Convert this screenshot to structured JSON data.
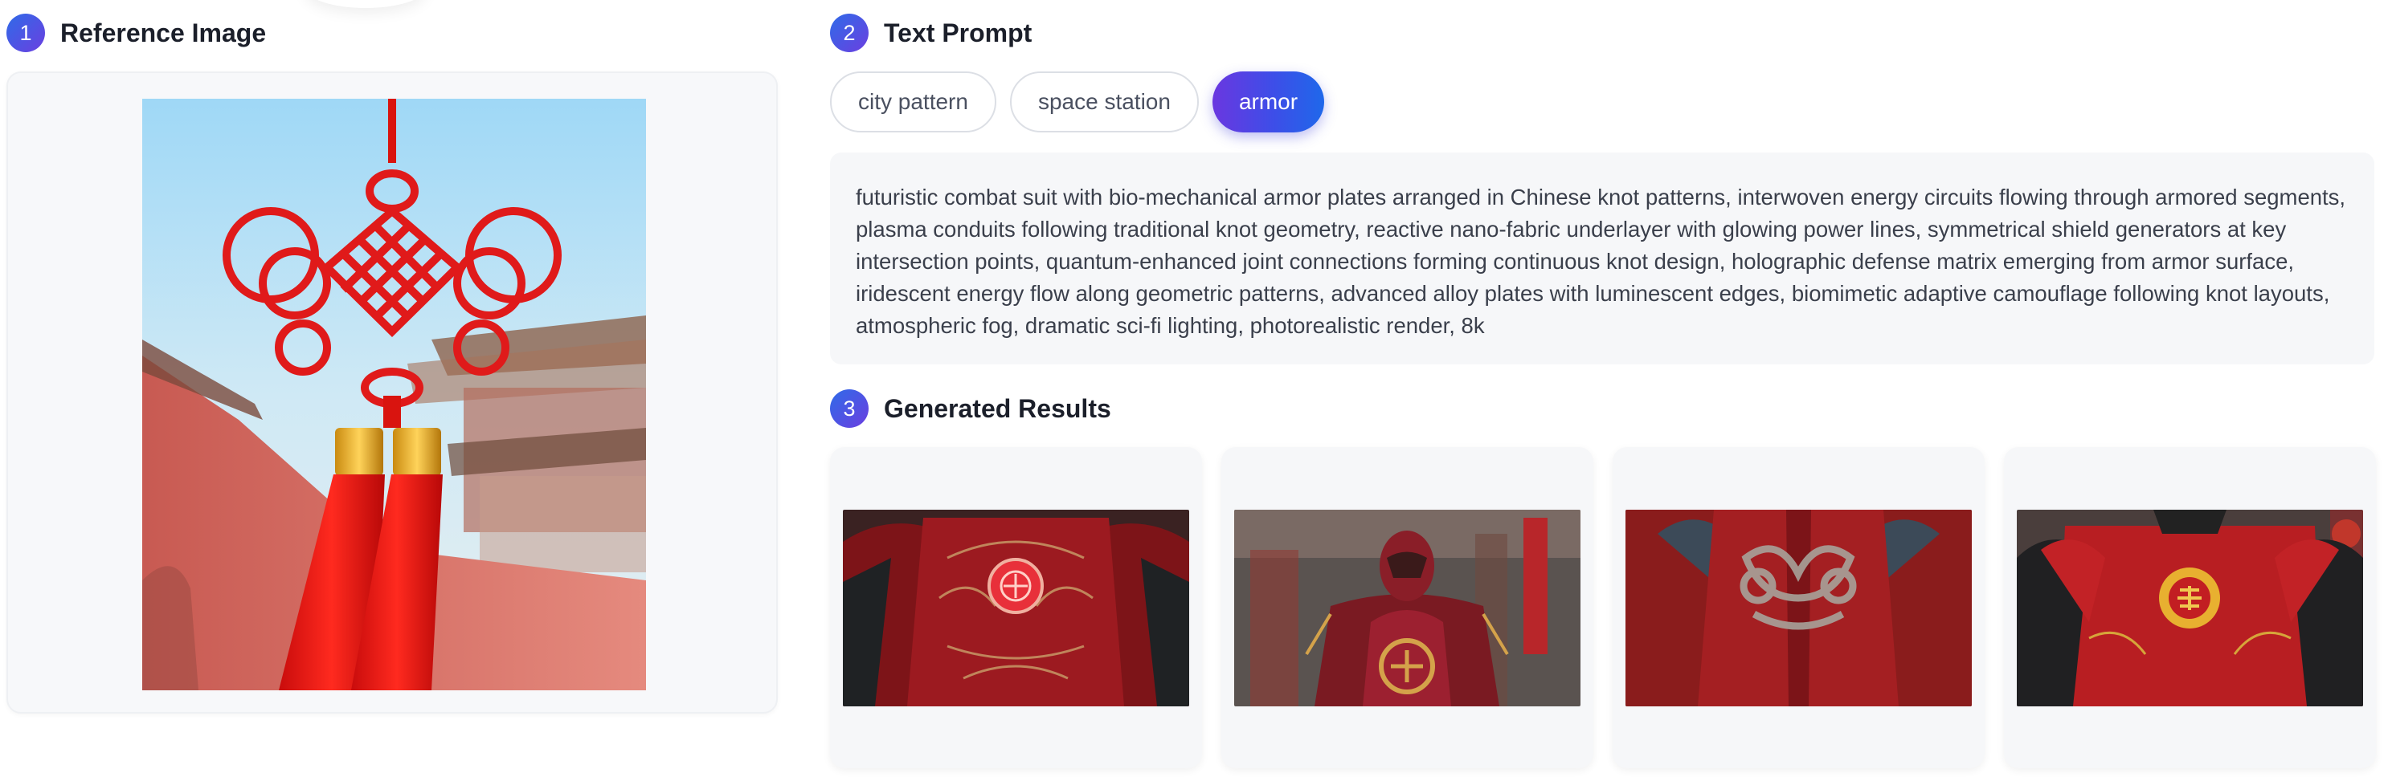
{
  "sections": {
    "reference": {
      "step": "1",
      "title": "Reference Image"
    },
    "prompt": {
      "step": "2",
      "title": "Text Prompt"
    },
    "results": {
      "step": "3",
      "title": "Generated Results"
    }
  },
  "reference_image": {
    "subject": "red chinese knot with tassels in front of palace wall"
  },
  "chips": [
    {
      "label": "city pattern",
      "active": false
    },
    {
      "label": "space station",
      "active": false
    },
    {
      "label": "armor",
      "active": true
    }
  ],
  "prompt_text": "futuristic combat suit with bio-mechanical armor plates arranged in Chinese knot patterns, interwoven energy circuits flowing through armored segments, plasma conduits following traditional knot geometry, reactive nano-fabric underlayer with glowing power lines, symmetrical shield generators at key intersection points, quantum-enhanced joint connections forming continuous knot design, holographic defense matrix emerging from armor surface, iridescent energy flow along geometric patterns, advanced alloy plates with luminescent edges, biomimetic adaptive camouflage following knot layouts, atmospheric fog, dramatic sci-fi lighting, photorealistic render, 8k",
  "results": [
    {
      "subject": "red armor chest plate with round emblem"
    },
    {
      "subject": "armored figure with helmet in red street"
    },
    {
      "subject": "red leather armor with knot embroidery"
    },
    {
      "subject": "red armor with golden round emblem"
    }
  ],
  "colors": {
    "accent_start": "#6a37e0",
    "accent_end": "#1f68ea",
    "knot_red": "#e01a1a"
  }
}
